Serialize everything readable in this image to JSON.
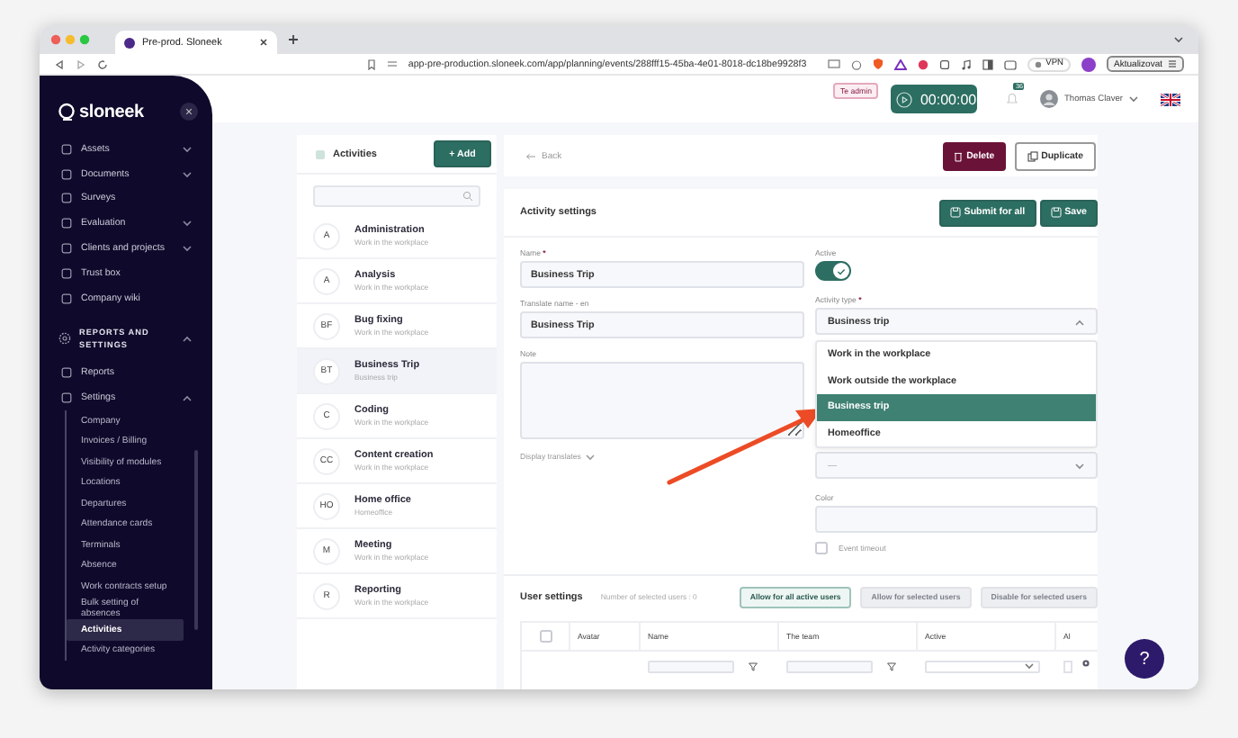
{
  "browser": {
    "tab_title": "Pre-prod. Sloneek",
    "url": "app-pre-production.sloneek.com/app/planning/events/288fff15-45ba-4e01-8018-dc18be9928f3",
    "vpn": "VPN",
    "update_button": "Aktualizovat"
  },
  "sidebar": {
    "logo": "sloneek",
    "items": [
      {
        "label": "Assets",
        "expandable": true
      },
      {
        "label": "Documents",
        "expandable": true
      },
      {
        "label": "Surveys",
        "expandable": false
      },
      {
        "label": "Evaluation",
        "expandable": true
      },
      {
        "label": "Clients and projects",
        "expandable": true
      },
      {
        "label": "Trust box",
        "expandable": false
      },
      {
        "label": "Company wiki",
        "expandable": false
      }
    ],
    "section": {
      "title": "REPORTS AND SETTINGS",
      "expanded": true
    },
    "section_items": [
      {
        "label": "Reports",
        "expandable": false
      },
      {
        "label": "Settings",
        "expandable": true,
        "expanded": true
      }
    ],
    "settings_children": [
      {
        "label": "Company",
        "selected": false
      },
      {
        "label": "Invoices / Billing",
        "selected": false
      },
      {
        "label": "Visibility of modules",
        "selected": false
      },
      {
        "label": "Locations",
        "selected": false
      },
      {
        "label": "Departures",
        "selected": false
      },
      {
        "label": "Attendance cards",
        "selected": false
      },
      {
        "label": "Terminals",
        "selected": false
      },
      {
        "label": "Absence",
        "selected": false
      },
      {
        "label": "Work contracts setup",
        "selected": false
      },
      {
        "label": "Bulk setting of absences",
        "selected": false
      },
      {
        "label": "Activities",
        "selected": true
      },
      {
        "label": "Activity categories",
        "selected": false
      }
    ]
  },
  "header": {
    "badge": "Te admin",
    "timer": "00:00:00",
    "notification_count": "36",
    "user": "Thomas Claver"
  },
  "activities": {
    "title": "Activities",
    "add_button": "+ Add",
    "items": [
      {
        "initials": "A",
        "name": "Administration",
        "type": "Work in the workplace",
        "selected": false
      },
      {
        "initials": "A",
        "name": "Analysis",
        "type": "Work in the workplace",
        "selected": false
      },
      {
        "initials": "BF",
        "name": "Bug fixing",
        "type": "Work in the workplace",
        "selected": false
      },
      {
        "initials": "BT",
        "name": "Business Trip",
        "type": "Business trip",
        "selected": true
      },
      {
        "initials": "C",
        "name": "Coding",
        "type": "Work in the workplace",
        "selected": false
      },
      {
        "initials": "CC",
        "name": "Content creation",
        "type": "Work in the workplace",
        "selected": false
      },
      {
        "initials": "HO",
        "name": "Home office",
        "type": "Homeoffice",
        "selected": false
      },
      {
        "initials": "M",
        "name": "Meeting",
        "type": "Work in the workplace",
        "selected": false
      },
      {
        "initials": "R",
        "name": "Reporting",
        "type": "Work in the workplace",
        "selected": false
      }
    ]
  },
  "detail": {
    "back": "Back",
    "delete_button": "Delete",
    "duplicate_button": "Duplicate",
    "settings_title": "Activity settings",
    "submit_button": "Submit for all",
    "save_button": "Save",
    "name": {
      "label": "Name",
      "required_mark": "*",
      "value": "Business Trip"
    },
    "translate_name": {
      "label": "Translate name - en",
      "value": "Business Trip"
    },
    "note": {
      "label": "Note"
    },
    "display_translates": "Display translates",
    "active": {
      "label": "Active",
      "on": true
    },
    "activity_type": {
      "label": "Activity type",
      "required_mark": "*",
      "value": "Business trip",
      "expanded": true,
      "options": [
        {
          "label": "Work in the workplace",
          "selected": false
        },
        {
          "label": "Work outside the workplace",
          "selected": false
        },
        {
          "label": "Business trip",
          "selected": true
        },
        {
          "label": "Homeoffice",
          "selected": false
        }
      ]
    },
    "hidden_select": {
      "placeholder": "—"
    },
    "color": {
      "label": "Color"
    },
    "event_timeout": {
      "label": "Event timeout",
      "checked": false
    }
  },
  "user_settings": {
    "title": "User settings",
    "selected_count": "Number of selected users : 0",
    "buttons": [
      {
        "label": "Allow for all active users",
        "disabled": false
      },
      {
        "label": "Allow for selected users",
        "disabled": true
      },
      {
        "label": "Disable for selected users",
        "disabled": true
      }
    ],
    "select_all_checked": false,
    "columns": [
      {
        "label": "Avatar",
        "kind": "plain"
      },
      {
        "label": "Name",
        "kind": "text"
      },
      {
        "label": "The team",
        "kind": "text"
      },
      {
        "label": "Active",
        "kind": "select"
      },
      {
        "label": "Al",
        "kind": "input"
      }
    ]
  },
  "help_button": "?"
}
